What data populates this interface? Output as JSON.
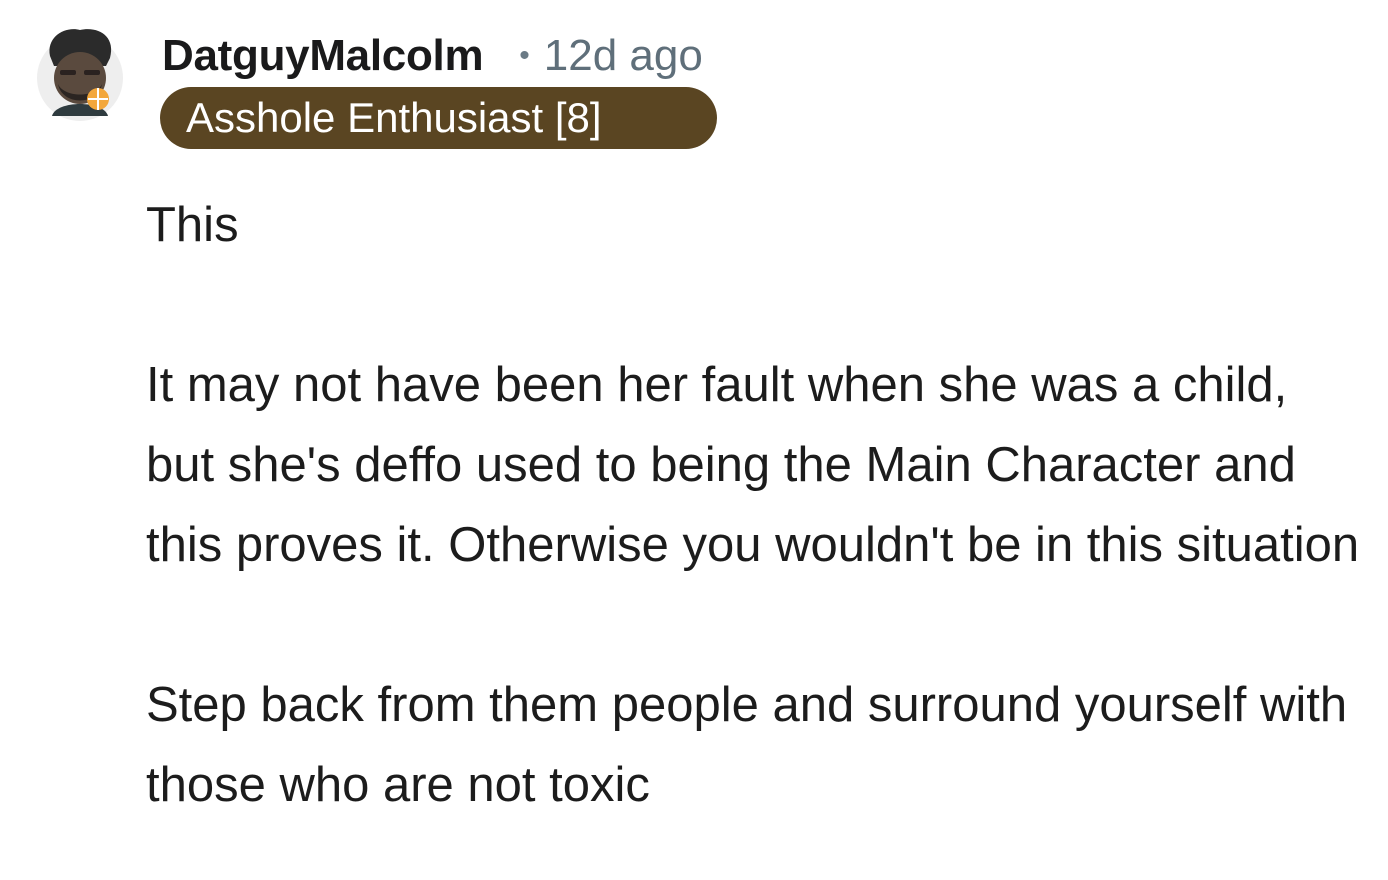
{
  "comment": {
    "username": "DatguyMalcolm",
    "separator": "•",
    "timestamp": "12d ago",
    "flair": "Asshole Enthusiast [8]",
    "paragraphs": [
      "This",
      "It may not have been her fault when she was a child, but she's deffo used to being the Main Character and this proves it. Otherwise you wouldn't be in this situation",
      "Step back from them people and surround yourself with those who are not toxic"
    ]
  },
  "colors": {
    "flair_background": "#5a4522",
    "flair_text": "#ffffff",
    "timestamp": "#5f6f7a",
    "body_text": "#1c1c1c"
  },
  "icons": {
    "avatar": "user-avatar-icon"
  }
}
